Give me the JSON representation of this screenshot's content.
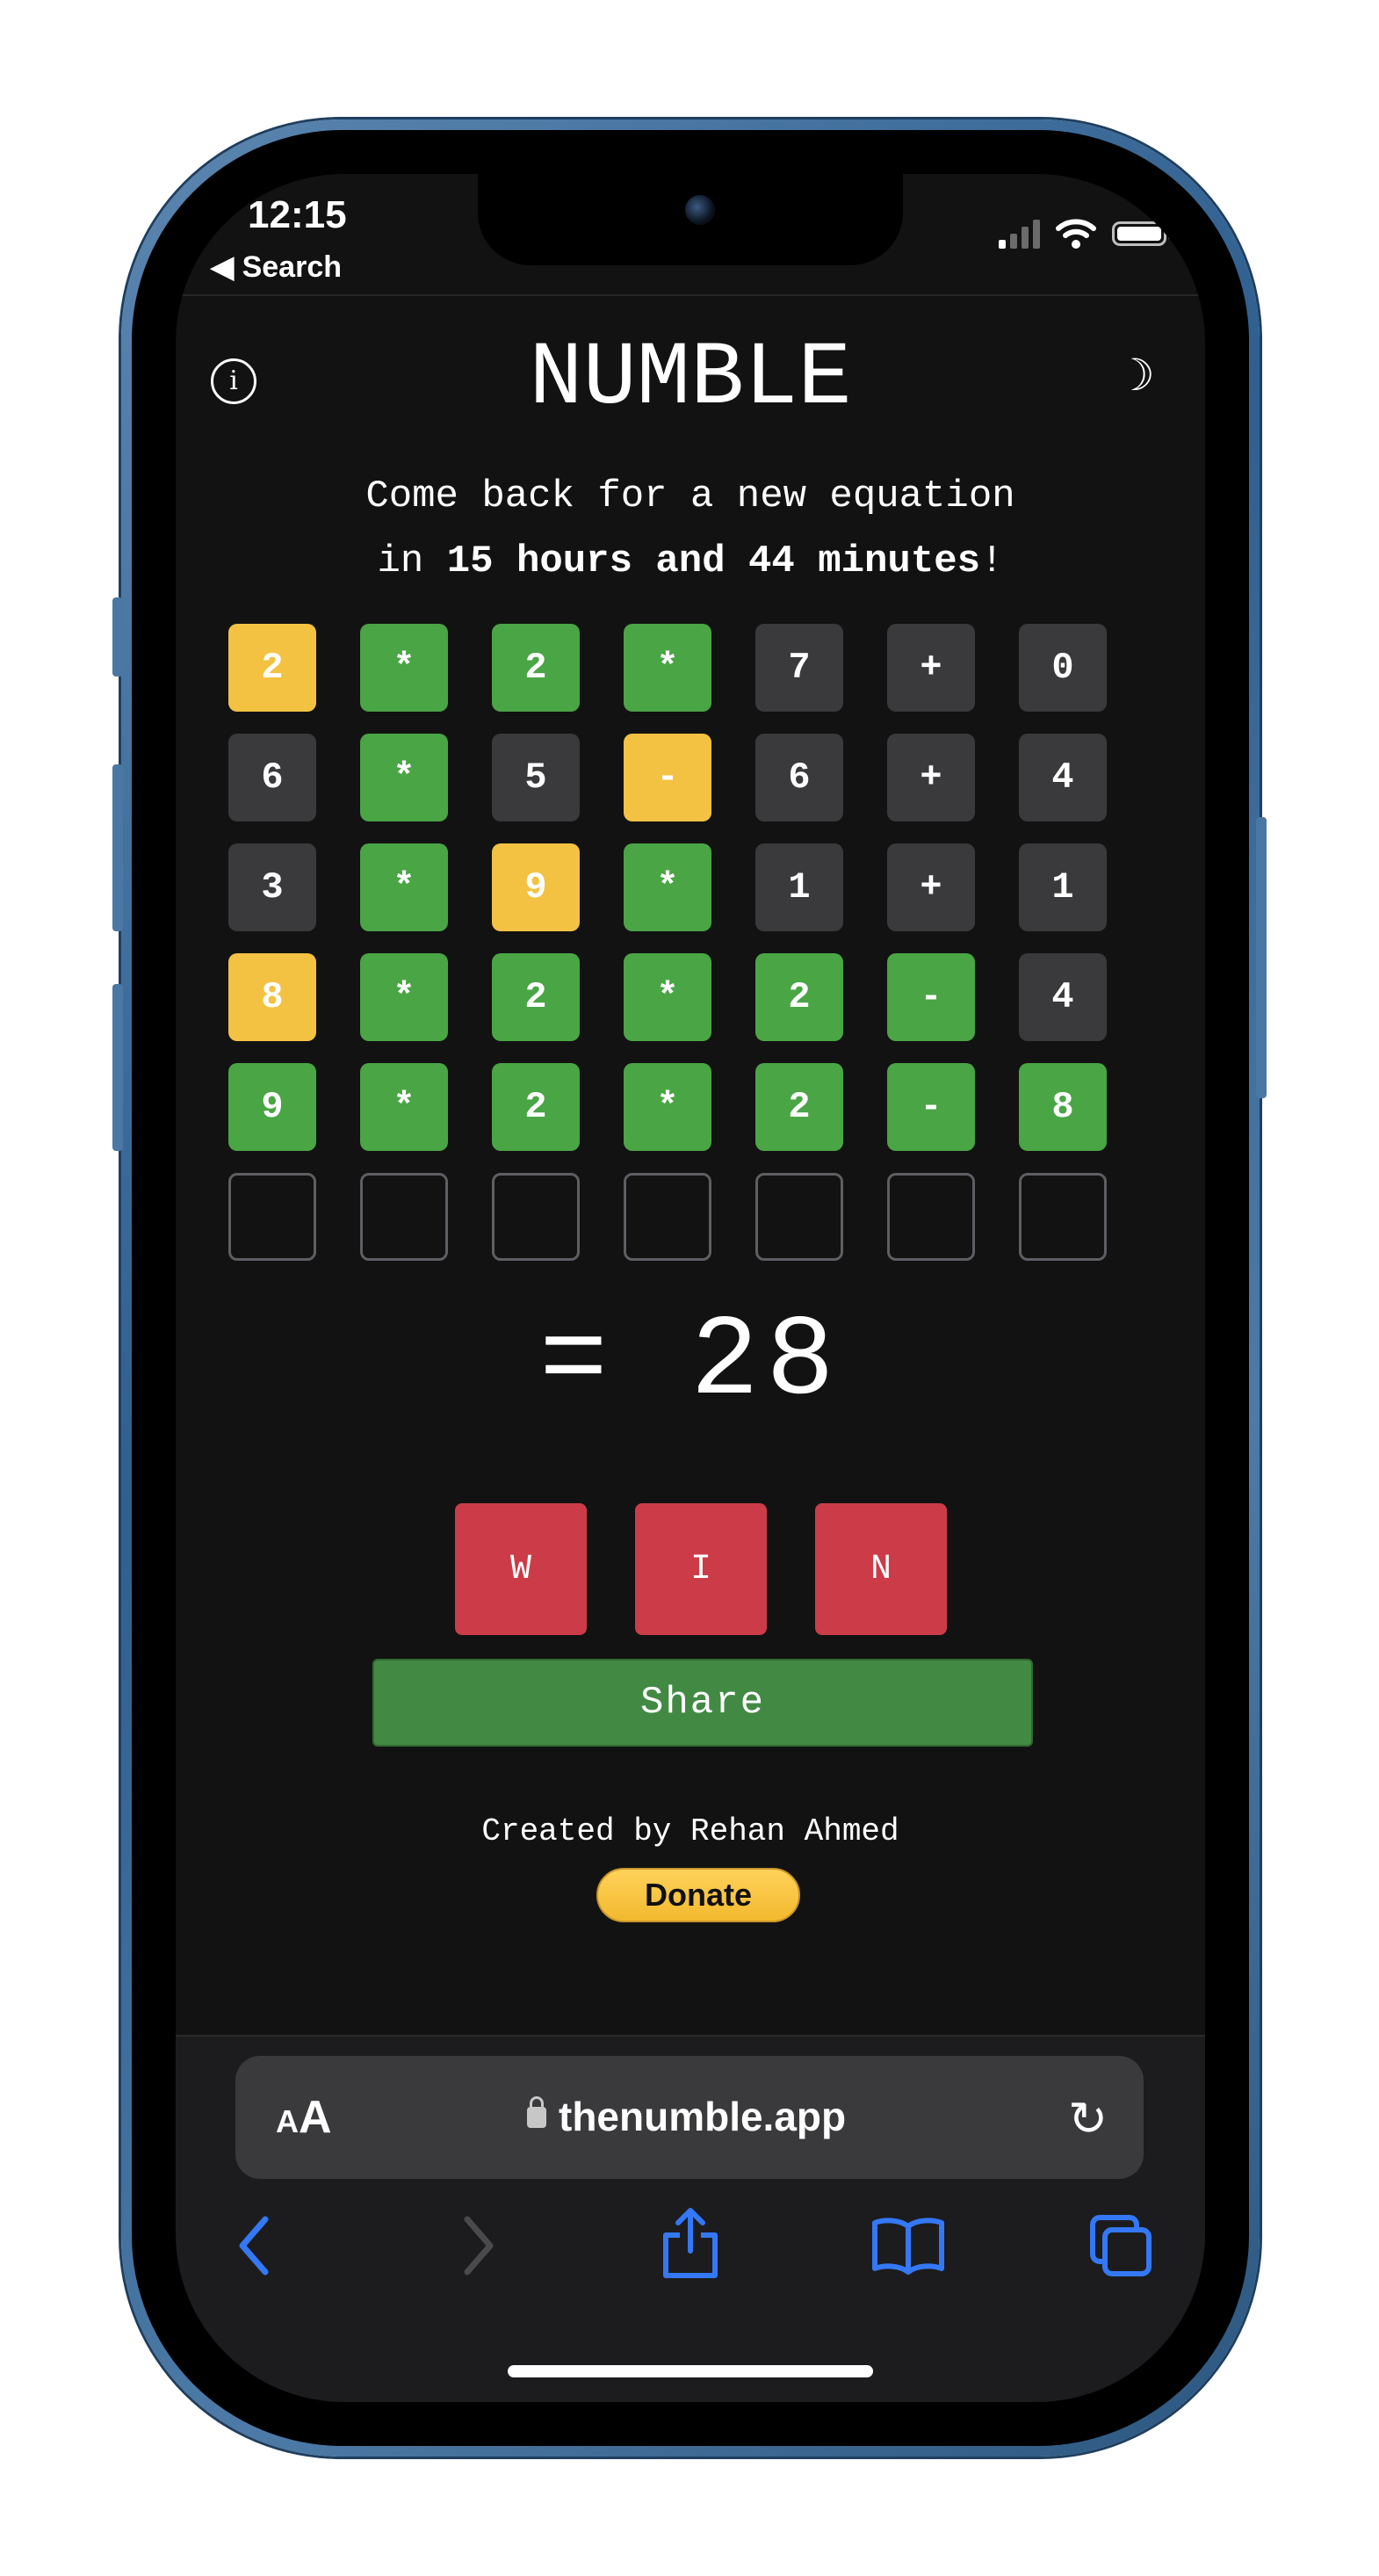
{
  "status": {
    "time": "12:15",
    "back_label": "◀ Search"
  },
  "header": {
    "title": "NUMBLE",
    "info_icon": "info-icon",
    "theme_icon": "moon-icon"
  },
  "message": {
    "line1": "Come back for a new equation",
    "line2_prefix": "in ",
    "line2_bold": "15 hours and 44 minutes",
    "line2_suffix": "!"
  },
  "grid": [
    [
      {
        "ch": "2",
        "c": "yellow"
      },
      {
        "ch": "*",
        "c": "green"
      },
      {
        "ch": "2",
        "c": "green"
      },
      {
        "ch": "*",
        "c": "green"
      },
      {
        "ch": "7",
        "c": "gray"
      },
      {
        "ch": "+",
        "c": "gray"
      },
      {
        "ch": "0",
        "c": "gray"
      }
    ],
    [
      {
        "ch": "6",
        "c": "gray"
      },
      {
        "ch": "*",
        "c": "green"
      },
      {
        "ch": "5",
        "c": "gray"
      },
      {
        "ch": "-",
        "c": "yellow"
      },
      {
        "ch": "6",
        "c": "gray"
      },
      {
        "ch": "+",
        "c": "gray"
      },
      {
        "ch": "4",
        "c": "gray"
      }
    ],
    [
      {
        "ch": "3",
        "c": "gray"
      },
      {
        "ch": "*",
        "c": "green"
      },
      {
        "ch": "9",
        "c": "yellow"
      },
      {
        "ch": "*",
        "c": "green"
      },
      {
        "ch": "1",
        "c": "gray"
      },
      {
        "ch": "+",
        "c": "gray"
      },
      {
        "ch": "1",
        "c": "gray"
      }
    ],
    [
      {
        "ch": "8",
        "c": "yellow"
      },
      {
        "ch": "*",
        "c": "green"
      },
      {
        "ch": "2",
        "c": "green"
      },
      {
        "ch": "*",
        "c": "green"
      },
      {
        "ch": "2",
        "c": "green"
      },
      {
        "ch": "-",
        "c": "green"
      },
      {
        "ch": "4",
        "c": "gray"
      }
    ],
    [
      {
        "ch": "9",
        "c": "green"
      },
      {
        "ch": "*",
        "c": "green"
      },
      {
        "ch": "2",
        "c": "green"
      },
      {
        "ch": "*",
        "c": "green"
      },
      {
        "ch": "2",
        "c": "green"
      },
      {
        "ch": "-",
        "c": "green"
      },
      {
        "ch": "8",
        "c": "green"
      }
    ],
    [
      {
        "ch": "",
        "c": "empty"
      },
      {
        "ch": "",
        "c": "empty"
      },
      {
        "ch": "",
        "c": "empty"
      },
      {
        "ch": "",
        "c": "empty"
      },
      {
        "ch": "",
        "c": "empty"
      },
      {
        "ch": "",
        "c": "empty"
      },
      {
        "ch": "",
        "c": "empty"
      }
    ]
  ],
  "target": "= 28",
  "result_tiles": [
    "W",
    "I",
    "N"
  ],
  "share_label": "Share",
  "credit": "Created by Rehan Ahmed",
  "donate_label": "Donate",
  "browser": {
    "url": "thenumble.app",
    "text_size_small": "A",
    "text_size_big": "A"
  },
  "colors": {
    "green": "#4aa545",
    "yellow": "#f4c242",
    "gray": "#3a3a3c",
    "red": "#cc3c48",
    "share": "#428a43",
    "safari_blue": "#3478f6"
  }
}
